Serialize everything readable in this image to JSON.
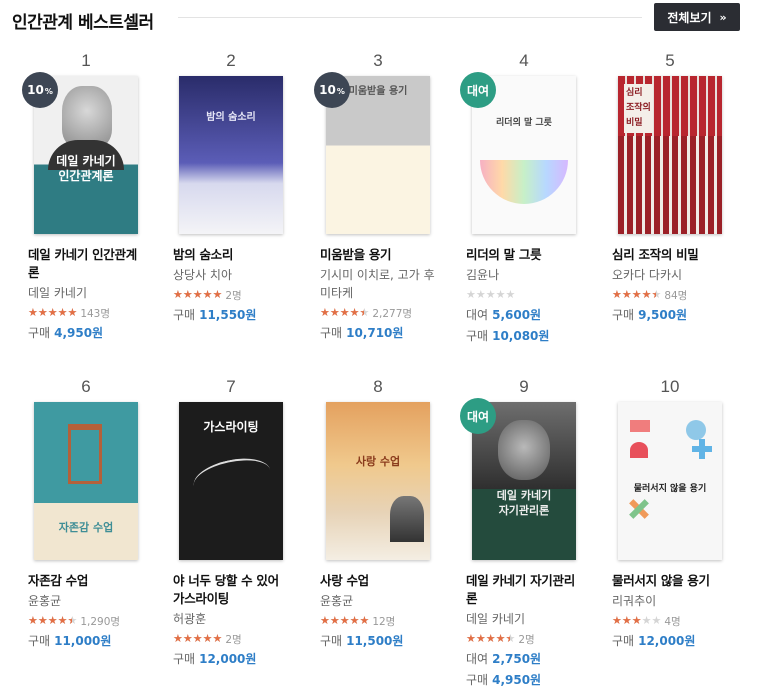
{
  "header": {
    "title": "인간관계 베스트셀러",
    "more_label": "전체보기",
    "more_icon": "chevron-right-icon"
  },
  "colors": {
    "accent_price": "#2e7ec7",
    "star": "#e36f45",
    "badge_sale": "#3d4654",
    "badge_rent": "#2d9d84"
  },
  "books": [
    {
      "rank": "1",
      "badge": "10",
      "badge_suffix": "%",
      "badge_type": "sale",
      "cover_title": "데일 카네기\n인간관계론",
      "title": "데일 카네기 인간관계론",
      "author": "데일 카네기",
      "rating": 5,
      "rating_count": "143명",
      "prices": [
        {
          "label": "구매",
          "amount": "4,950원"
        }
      ]
    },
    {
      "rank": "2",
      "badge": "",
      "badge_type": "",
      "cover_title": "밤의 숨소리",
      "title": "밤의 숨소리",
      "author": "상당사 치아",
      "rating": 5,
      "rating_count": "2명",
      "prices": [
        {
          "label": "구매",
          "amount": "11,550원"
        }
      ]
    },
    {
      "rank": "3",
      "badge": "10",
      "badge_suffix": "%",
      "badge_type": "sale",
      "cover_title": "미움받을 용기",
      "title": "미움받을 용기",
      "author": "기시미 이치로, 고가 후미타케",
      "rating": 4.5,
      "rating_count": "2,277명",
      "prices": [
        {
          "label": "구매",
          "amount": "10,710원"
        }
      ]
    },
    {
      "rank": "4",
      "badge": "대여",
      "badge_type": "rent",
      "cover_title": "리더의 말 그릇",
      "title": "리더의 말 그릇",
      "author": "김윤나",
      "rating": 0,
      "rating_count": "",
      "prices": [
        {
          "label": "대여",
          "amount": "5,600원"
        },
        {
          "label": "구매",
          "amount": "10,080원"
        }
      ]
    },
    {
      "rank": "5",
      "badge": "",
      "badge_type": "",
      "cover_title": "심리\n조작의\n비밀",
      "title": "심리 조작의 비밀",
      "author": "오카다 다카시",
      "rating": 4.5,
      "rating_count": "84명",
      "prices": [
        {
          "label": "구매",
          "amount": "9,500원"
        }
      ]
    },
    {
      "rank": "6",
      "badge": "",
      "badge_type": "",
      "cover_title": "자존감 수업",
      "title": "자존감 수업",
      "author": "윤홍균",
      "rating": 4.5,
      "rating_count": "1,290명",
      "prices": [
        {
          "label": "구매",
          "amount": "11,000원"
        }
      ]
    },
    {
      "rank": "7",
      "badge": "",
      "badge_type": "",
      "cover_title": "가스라이팅",
      "title": "야 너두 당할 수 있어 가스라이팅",
      "author": "허광훈",
      "rating": 5,
      "rating_count": "2명",
      "prices": [
        {
          "label": "구매",
          "amount": "12,000원"
        }
      ]
    },
    {
      "rank": "8",
      "badge": "",
      "badge_type": "",
      "cover_title": "사랑 수업",
      "title": "사랑 수업",
      "author": "윤홍균",
      "rating": 5,
      "rating_count": "12명",
      "prices": [
        {
          "label": "구매",
          "amount": "11,500원"
        }
      ]
    },
    {
      "rank": "9",
      "badge": "대여",
      "badge_type": "rent",
      "cover_title": "데일 카네기\n자기관리론",
      "title": "데일 카네기 자기관리론",
      "author": "데일 카네기",
      "rating": 4.5,
      "rating_count": "2명",
      "prices": [
        {
          "label": "대여",
          "amount": "2,750원"
        },
        {
          "label": "구매",
          "amount": "4,950원"
        }
      ]
    },
    {
      "rank": "10",
      "badge": "",
      "badge_type": "",
      "cover_title": "물러서지 않을 용기",
      "title": "물러서지 않을 용기",
      "author": "리궈추이",
      "rating": 3,
      "rating_count": "4명",
      "prices": [
        {
          "label": "구매",
          "amount": "12,000원"
        }
      ]
    }
  ]
}
